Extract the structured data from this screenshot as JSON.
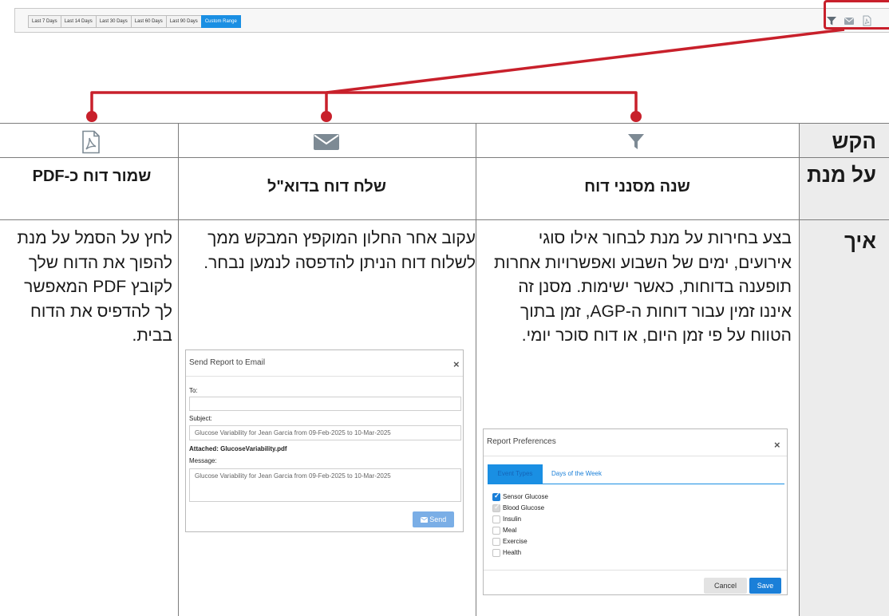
{
  "toolbar": {
    "range_buttons": [
      {
        "label": "Last 7 Days",
        "active": false
      },
      {
        "label": "Last 14 Days",
        "active": false
      },
      {
        "label": "Last 30 Days",
        "active": false
      },
      {
        "label": "Last 60 Days",
        "active": false
      },
      {
        "label": "Last 90 Days",
        "active": false
      },
      {
        "label": "Custom Range",
        "active": true
      }
    ],
    "icons": [
      "filter-icon",
      "envelope-icon",
      "pdf-icon"
    ],
    "icon_color": "#9aa4ad",
    "active_color": "#1a8fe3"
  },
  "accent_color": "#c8202b",
  "table": {
    "row_labels": {
      "key": "הקש",
      "purpose": "על מנת",
      "how": "איך"
    },
    "columns": [
      {
        "icon": "filter-icon",
        "title": "שנה מסנני דוח",
        "body": "בצע בחירות על מנת לבחור אילו סוגי אירועים, ימים של השבוע ואפשרויות אחרות תופענה בדוחות, כאשר ישימות. מסנן זה איננו זמין עבור דוחות ה-AGP, זמן בתוך הטווח על פי זמן היום, או דוח סוכר יומי."
      },
      {
        "icon": "envelope-icon",
        "title": "שלח דוח בדוא\"ל",
        "body": "עקוב אחר החלון המוקפץ המבקש ממך לשלוח דוח הניתן להדפסה לנמען נבחר."
      },
      {
        "icon": "pdf-icon",
        "title": "שמור דוח כ-PDF",
        "body": "לחץ על הסמל על מנת להפוך את הדוח שלך לקובץ PDF המאפשר לך להדפיס את הדוח בבית."
      }
    ],
    "icon_color": "#7d8a94"
  },
  "email_dialog": {
    "title": "Send Report to Email",
    "close": "×",
    "to_label": "To:",
    "to_value": "",
    "subject_label": "Subject:",
    "subject_value": "Glucose Variability for Jean Garcia from 09-Feb-2025 to 10-Mar-2025",
    "attached_label": "Attached: GlucoseVariability.pdf",
    "message_label": "Message:",
    "message_value": "Glucose Variability for Jean Garcia from 09-Feb-2025 to 10-Mar-2025",
    "send_label": "Send",
    "send_icon": "envelope-icon"
  },
  "prefs_dialog": {
    "title": "Report Preferences",
    "close": "×",
    "tabs": [
      {
        "label": "Event Types",
        "active": true
      },
      {
        "label": "Days of the Week",
        "active": false
      }
    ],
    "options": [
      {
        "label": "Sensor Glucose",
        "state": "checked"
      },
      {
        "label": "Blood Glucose",
        "state": "partial"
      },
      {
        "label": "Insulin",
        "state": "unchecked"
      },
      {
        "label": "Meal",
        "state": "unchecked"
      },
      {
        "label": "Exercise",
        "state": "unchecked"
      },
      {
        "label": "Health",
        "state": "unchecked"
      }
    ],
    "cancel_label": "Cancel",
    "save_label": "Save"
  }
}
